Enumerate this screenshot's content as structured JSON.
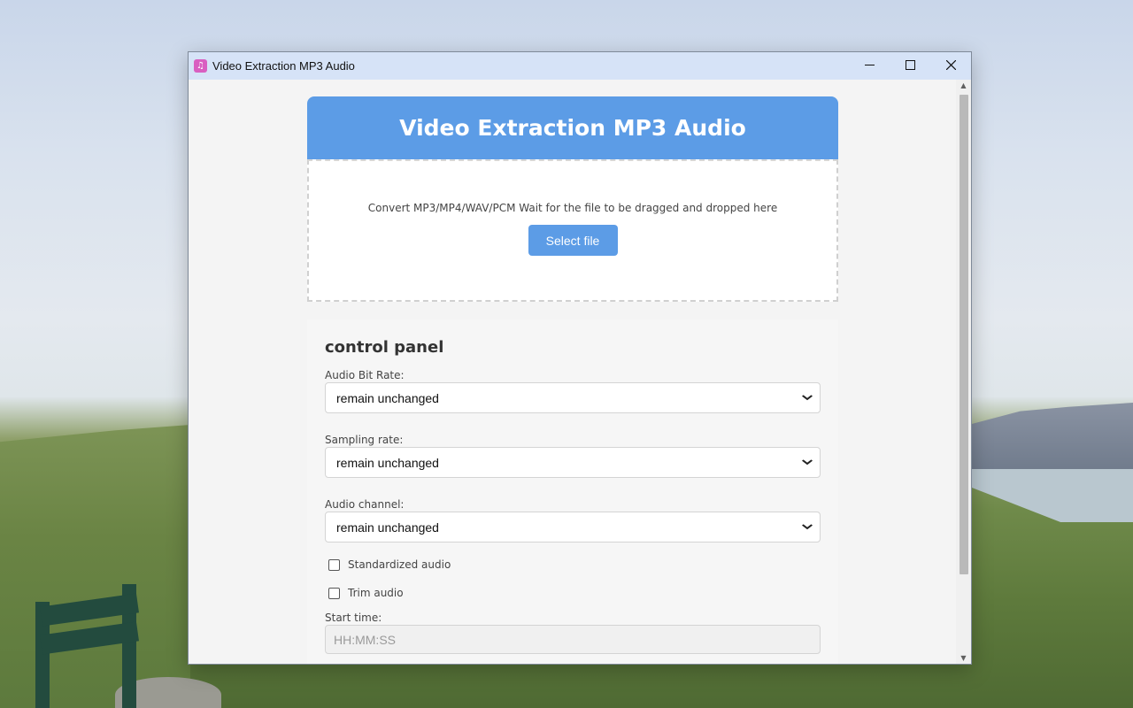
{
  "window": {
    "title": "Video Extraction MP3 Audio",
    "app_icon": "music-note-icon",
    "controls": {
      "minimize": "─",
      "maximize": "☐",
      "close": "✕"
    }
  },
  "app": {
    "header_title": "Video Extraction MP3 Audio",
    "drop_zone": {
      "text": "Convert MP3/MP4/WAV/PCM Wait for the file to be dragged and dropped here",
      "button_label": "Select file"
    },
    "control_panel": {
      "title": "control panel",
      "bit_rate": {
        "label": "Audio Bit Rate:",
        "value": "remain unchanged"
      },
      "sampling_rate": {
        "label": "Sampling rate:",
        "value": "remain unchanged"
      },
      "channel": {
        "label": "Audio channel:",
        "value": "remain unchanged"
      },
      "standardize": {
        "label": "Standardized audio",
        "checked": false
      },
      "trim": {
        "label": "Trim audio",
        "checked": false
      },
      "start_time": {
        "label": "Start time:",
        "placeholder": "HH:MM:SS"
      }
    }
  },
  "colors": {
    "accent": "#5c9ce6",
    "titlebar": "#d6e3f7"
  }
}
